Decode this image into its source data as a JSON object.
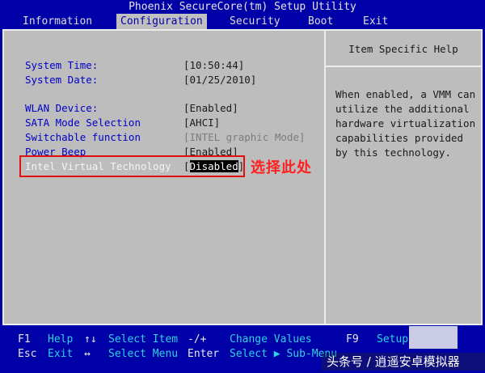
{
  "title": "Phoenix SecureCore(tm) Setup Utility",
  "menu": [
    {
      "label": "Information",
      "active": false
    },
    {
      "label": "Configuration",
      "active": true
    },
    {
      "label": "Security",
      "active": false
    },
    {
      "label": "Boot",
      "active": false
    },
    {
      "label": "Exit",
      "active": false
    }
  ],
  "settings": [
    {
      "label": "System Time:",
      "value": "[10:50:44]"
    },
    {
      "label": "System Date:",
      "value": "[01/25/2010]"
    },
    {
      "label": "WLAN Device:",
      "value": "[Enabled]"
    },
    {
      "label": "SATA Mode Selection",
      "value": "[AHCI]"
    },
    {
      "label": "Switchable function",
      "value": "[INTEL graphic Mode]"
    },
    {
      "label": "Power Beep",
      "value": "[Enabled]"
    },
    {
      "label": "Intel Virtual Technology",
      "value_prefix": "[",
      "value": "Disabled",
      "value_suffix": "]"
    }
  ],
  "help": {
    "title": "Item Specific Help",
    "text": "When enabled, a VMM can\nutilize the additional\nhardware virtualization\ncapabilities provided\nby this technology."
  },
  "annotation": "选择此处",
  "footer": {
    "row1": [
      {
        "key": "F1",
        "desc": "Help"
      },
      {
        "key": "↑↓",
        "desc": "Select Item"
      },
      {
        "key": "-/+",
        "desc": "Change Values"
      },
      {
        "key": "F9",
        "desc": "Setup"
      }
    ],
    "row2": [
      {
        "key": "Esc",
        "desc": "Exit"
      },
      {
        "key": "↔",
        "desc": "Select Menu"
      },
      {
        "key": "Enter",
        "desc": "Select ▶ Sub-Menu"
      }
    ]
  },
  "watermark": "头条号 / 逍遥安卓模拟器",
  "colors": {
    "background": "#0000a8",
    "panel": "#bdbdbd",
    "label": "#0000c8",
    "footer_desc": "#2ed3e0",
    "annotation": "#ff2020"
  }
}
